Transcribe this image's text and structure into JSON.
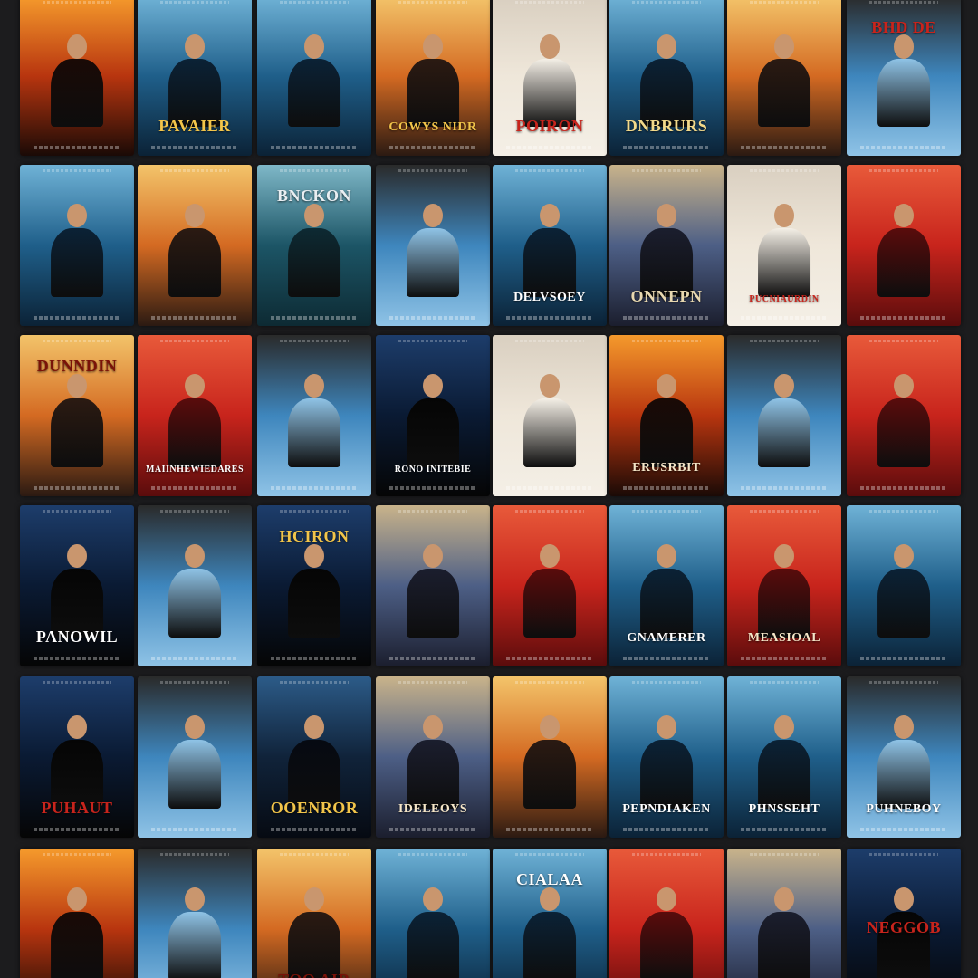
{
  "palettes": {
    "fire": [
      "#1a0a06",
      "#b8350f",
      "#f59a2c"
    ],
    "ocean": [
      "#0b2236",
      "#1f5f8a",
      "#6fb2d6"
    ],
    "sky": [
      "#8fc3e6",
      "#3e86bd",
      "#2a2a2a"
    ],
    "red": [
      "#5a0c0c",
      "#c8241c",
      "#e85a3a"
    ],
    "dark": [
      "#060a12",
      "#10233a",
      "#2c5b88"
    ],
    "sunset": [
      "#2b1a12",
      "#d46a22",
      "#f3c46a"
    ],
    "cream": [
      "#f4efe6",
      "#efe7da",
      "#d9cfc0"
    ],
    "teal": [
      "#0d2a33",
      "#1c5566",
      "#7fb8c8"
    ],
    "night": [
      "#050505",
      "#0a1a33",
      "#1d3d6b"
    ],
    "dusk": [
      "#1b1e2e",
      "#4d5f86",
      "#c9b38a"
    ]
  },
  "posters": [
    [
      {
        "p": "fire",
        "t": "",
        "tc": "#f5e6c8",
        "ty": "mid"
      },
      {
        "p": "ocean",
        "t": "PAVAIER",
        "tc": "#f2c54a",
        "ty": "bot"
      },
      {
        "p": "ocean",
        "t": "",
        "tc": "#ffffff",
        "ty": "bot"
      },
      {
        "p": "sunset",
        "t": "COWYS NIDR",
        "tc": "#f2c54a",
        "ty": "bot"
      },
      {
        "p": "cream",
        "t": "POIRON",
        "tc": "#c8241c",
        "ty": "bot"
      },
      {
        "p": "ocean",
        "t": "DNBRURS",
        "tc": "#f2d98a",
        "ty": "bot"
      },
      {
        "p": "sunset",
        "t": "",
        "tc": "#ffffff",
        "ty": "bot"
      },
      {
        "p": "sky",
        "t": "BHD DE",
        "tc": "#c8241c",
        "ty": "top"
      }
    ],
    [
      {
        "p": "ocean",
        "t": "",
        "tc": "#ffffff",
        "ty": "bot"
      },
      {
        "p": "sunset",
        "t": "",
        "tc": "#ffffff",
        "ty": "bot"
      },
      {
        "p": "teal",
        "t": "BNCKON",
        "tc": "#e9eef2",
        "ty": "top"
      },
      {
        "p": "sky",
        "t": "",
        "tc": "#ffffff",
        "ty": "top"
      },
      {
        "p": "ocean",
        "t": "DELVSOEY",
        "tc": "#ffffff",
        "ty": "bot"
      },
      {
        "p": "dusk",
        "t": "ONNEPN",
        "tc": "#e8d8b0",
        "ty": "bot"
      },
      {
        "p": "cream",
        "t": "PUCNIAURDIN",
        "tc": "#c8241c",
        "ty": "bot"
      },
      {
        "p": "red",
        "t": "",
        "tc": "#ffffff",
        "ty": "bot"
      }
    ],
    [
      {
        "p": "sunset",
        "t": "DUNNDIN",
        "tc": "#7a1208",
        "ty": "top"
      },
      {
        "p": "red",
        "t": "MAIINHEWIEDARES",
        "tc": "#ffffff",
        "ty": "bot"
      },
      {
        "p": "sky",
        "t": "",
        "tc": "#ffffff",
        "ty": "bot"
      },
      {
        "p": "night",
        "t": "RONO INITEBIE",
        "tc": "#ffffff",
        "ty": "bot"
      },
      {
        "p": "cream",
        "t": "",
        "tc": "#222222",
        "ty": "bot"
      },
      {
        "p": "fire",
        "t": "ERUSRBIT",
        "tc": "#f5e6c8",
        "ty": "bot"
      },
      {
        "p": "sky",
        "t": "",
        "tc": "#ffffff",
        "ty": "bot"
      },
      {
        "p": "red",
        "t": "",
        "tc": "#f5e6c8",
        "ty": "bot"
      }
    ],
    [
      {
        "p": "night",
        "t": "PANOWIL",
        "tc": "#ffffff",
        "ty": "bot"
      },
      {
        "p": "sky",
        "t": "",
        "tc": "#ffffff",
        "ty": "bot"
      },
      {
        "p": "night",
        "t": "HCIRON",
        "tc": "#f2c54a",
        "ty": "top"
      },
      {
        "p": "dusk",
        "t": "",
        "tc": "#ffffff",
        "ty": "bot"
      },
      {
        "p": "red",
        "t": "",
        "tc": "#f2c54a",
        "ty": "top"
      },
      {
        "p": "ocean",
        "t": "GNAMERER",
        "tc": "#ffffff",
        "ty": "bot"
      },
      {
        "p": "red",
        "t": "MEASIOAL",
        "tc": "#f5e6c8",
        "ty": "bot"
      },
      {
        "p": "ocean",
        "t": "",
        "tc": "#ffffff",
        "ty": "bot"
      }
    ],
    [
      {
        "p": "night",
        "t": "PUHAUT",
        "tc": "#c8241c",
        "ty": "bot"
      },
      {
        "p": "sky",
        "t": "",
        "tc": "#ffffff",
        "ty": "bot"
      },
      {
        "p": "dark",
        "t": "OOENROR",
        "tc": "#f2c54a",
        "ty": "bot"
      },
      {
        "p": "dusk",
        "t": "IDELEOYS",
        "tc": "#f5e6c8",
        "ty": "bot"
      },
      {
        "p": "sunset",
        "t": "",
        "tc": "#ffffff",
        "ty": "bot"
      },
      {
        "p": "ocean",
        "t": "PEPNDIAKEN",
        "tc": "#ffffff",
        "ty": "bot"
      },
      {
        "p": "ocean",
        "t": "PHNSSEHT",
        "tc": "#ffffff",
        "ty": "bot"
      },
      {
        "p": "sky",
        "t": "PUHNEBOY",
        "tc": "#ffffff",
        "ty": "bot"
      }
    ],
    [
      {
        "p": "fire",
        "t": "",
        "tc": "#f5e6c8",
        "ty": "bot"
      },
      {
        "p": "sky",
        "t": "",
        "tc": "#ffffff",
        "ty": "bot"
      },
      {
        "p": "sunset",
        "t": "TOO AIR",
        "tc": "#7a1208",
        "ty": "bot"
      },
      {
        "p": "ocean",
        "t": "",
        "tc": "#ffffff",
        "ty": "bot"
      },
      {
        "p": "ocean",
        "t": "CIALAA",
        "tc": "#ffffff",
        "ty": "top"
      },
      {
        "p": "red",
        "t": "",
        "tc": "#ffffff",
        "ty": "bot"
      },
      {
        "p": "dusk",
        "t": "",
        "tc": "#ffffff",
        "ty": "bot"
      },
      {
        "p": "night",
        "t": "NEGGOB",
        "tc": "#c8241c",
        "ty": "mid"
      }
    ]
  ]
}
